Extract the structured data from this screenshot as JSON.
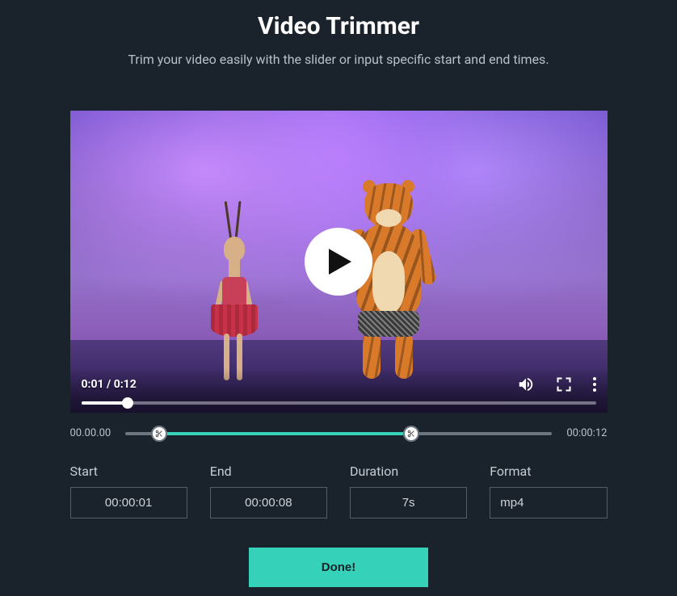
{
  "header": {
    "title": "Video Trimmer",
    "subtitle": "Trim your video easily with the slider or input specific start and end times."
  },
  "video": {
    "time_display": "0:01 / 0:12",
    "progress_pct": 9
  },
  "trim": {
    "min_label": "00.00.00",
    "max_label": "00:00:12",
    "start_pct": 8,
    "end_pct": 67
  },
  "fields": {
    "start": {
      "label": "Start",
      "value": "00:00:01"
    },
    "end": {
      "label": "End",
      "value": "00:00:08"
    },
    "duration": {
      "label": "Duration",
      "value": "7s"
    },
    "format": {
      "label": "Format",
      "value": "mp4"
    }
  },
  "actions": {
    "done_label": "Done!"
  },
  "colors": {
    "accent": "#35d2b9",
    "bg": "#1a222b"
  }
}
